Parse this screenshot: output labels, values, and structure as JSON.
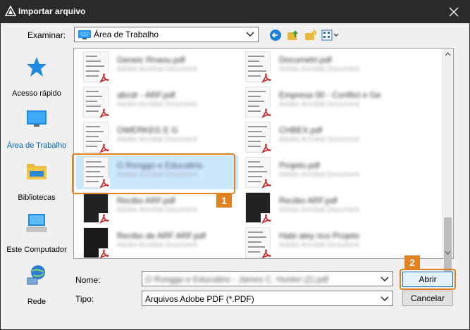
{
  "window": {
    "title": "Importar arquivo",
    "close_glyph": "✕"
  },
  "toolbar": {
    "lookin_label": "Examinar:",
    "lookin_value": "Área de Trabalho"
  },
  "places": [
    {
      "label": "Acesso rápido",
      "icon": "star-icon"
    },
    {
      "label": "Área de Trabalho",
      "icon": "desktop-icon"
    },
    {
      "label": "Bibliotecas",
      "icon": "libraries-icon"
    },
    {
      "label": "Este Computador",
      "icon": "computer-icon"
    },
    {
      "label": "Rede",
      "icon": "network-icon"
    }
  ],
  "files": [
    {
      "name": "Geneic Rnaou.pdf",
      "meta": "Adobe Acrobat Document"
    },
    {
      "name": "Documetri.pdf",
      "meta": "Adobe Acrobat Document"
    },
    {
      "name": "abcdr - ARF.pdf",
      "meta": "Adobe Acrobat Document"
    },
    {
      "name": "Empresa 00 - Conflict e Ge",
      "meta": "Adobe Acrobat Document"
    },
    {
      "name": "OWERKEG E G",
      "meta": "Adobe Acrobat Document"
    },
    {
      "name": "CHBEX.pdf",
      "meta": "Adobe Acrobat Document"
    },
    {
      "name": "O Ronggo e Educaltrio",
      "meta": "Adobe Acrobat Document"
    },
    {
      "name": "Projeto.pdf",
      "meta": "Adobe Acrobat Document"
    },
    {
      "name": "Recibo ARF.pdf",
      "meta": "Adobe Acrobat Document"
    },
    {
      "name": "Recibo ARF.pdf",
      "meta": "Adobe Acrobat Document"
    },
    {
      "name": "Recibo de ARF ARF.pdf",
      "meta": "Adobe Acrobat Document"
    },
    {
      "name": "Habi aley rico Projeto",
      "meta": "Adobe Acrobat Document"
    }
  ],
  "badges": {
    "file": "1",
    "open": "2"
  },
  "form": {
    "name_label": "Nome:",
    "name_value": "O Ronggo e Educaltrio - James C. Hunter (2).pdf",
    "type_label": "Tipo:",
    "type_value": "Arquivos Adobe PDF (*.PDF)"
  },
  "buttons": {
    "open": "Abrir",
    "cancel": "Cancelar"
  },
  "colors": {
    "titlebar": "#2b2b2b",
    "highlight": "#e08122",
    "selection": "#cce8ff",
    "accent": "#0063b1",
    "pdf": "#c81e1e"
  }
}
